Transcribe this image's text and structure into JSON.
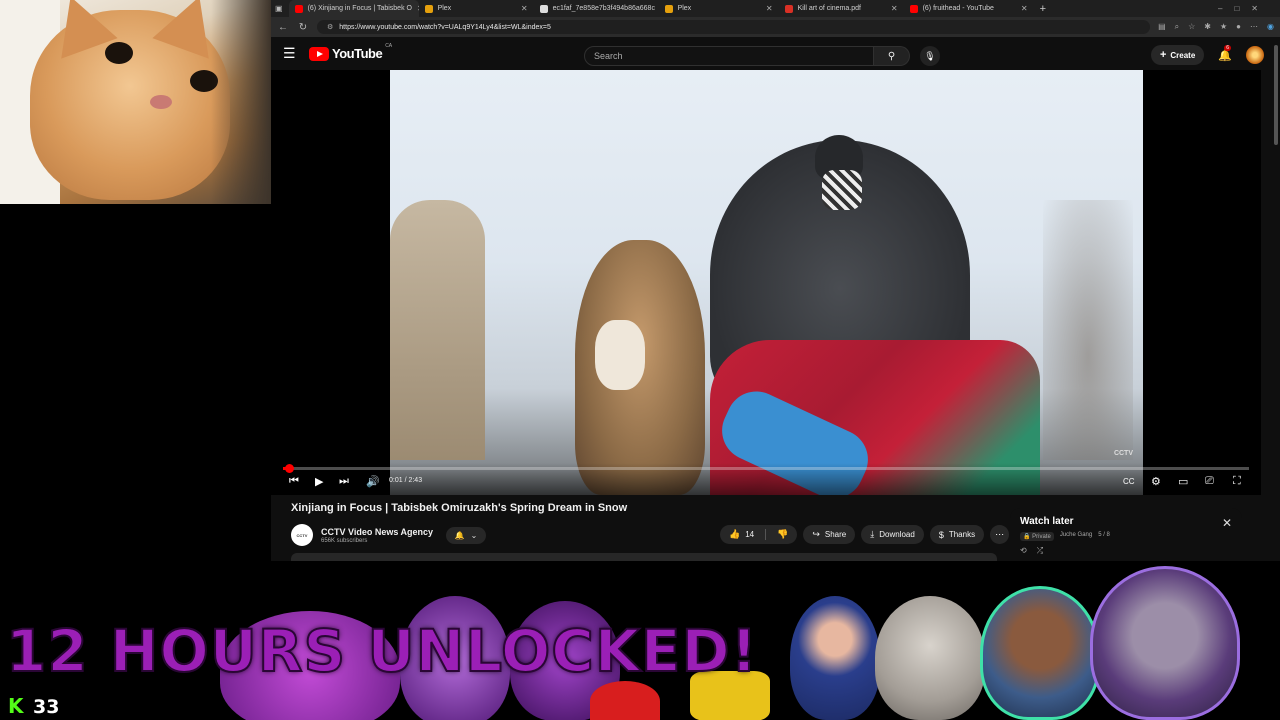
{
  "browser": {
    "tabs": [
      {
        "label": "(6) Xinjiang in Focus | Tabisbek O",
        "icon": "youtube-icon",
        "color": "#ff0000",
        "active": true
      },
      {
        "label": "Plex",
        "icon": "plex-icon",
        "color": "#e5a00d"
      },
      {
        "label": "ec1faf_7e858e7b3f494b86a668c",
        "icon": "document-icon",
        "color": "#dddddd"
      },
      {
        "label": "Plex",
        "icon": "plex-icon",
        "color": "#e5a00d"
      },
      {
        "label": "Kill art of cinema.pdf",
        "icon": "pdf-icon",
        "color": "#d93025"
      },
      {
        "label": "(6) fruithead - YouTube",
        "icon": "youtube-icon",
        "color": "#ff0000"
      }
    ],
    "url": "https://www.youtube.com/watch?v=UALq9Y14Ly4&list=WL&index=5"
  },
  "youtube": {
    "logo_text": "YouTube",
    "country_code": "CA",
    "search_placeholder": "Search",
    "create_label": "Create",
    "notification_count": "6"
  },
  "player": {
    "time_display": "0:01 / 2:43",
    "progress": 0.006,
    "watermark": "CCTV"
  },
  "video": {
    "title": "Xinjiang in Focus | Tabisbek Omiruzakh's Spring Dream in Snow",
    "channel_name": "CCTV Video News Agency",
    "channel_avatar_text": "CCTV",
    "subscribers": "656K subscribers",
    "likes": "14",
    "share_label": "Share",
    "download_label": "Download",
    "thanks_label": "Thanks"
  },
  "watch_later": {
    "title": "Watch later",
    "privacy": "Private",
    "owner": "Juche Gang",
    "position": "5 / 8"
  },
  "overlay": {
    "banner_text": "12 HOURS UNLOCKED!",
    "viewer_count": "33",
    "kick_logo": "K"
  },
  "colors": {
    "youtube_red": "#ff0000",
    "banner_purple": "#9b1fb6",
    "kick_green": "#53fc18"
  }
}
